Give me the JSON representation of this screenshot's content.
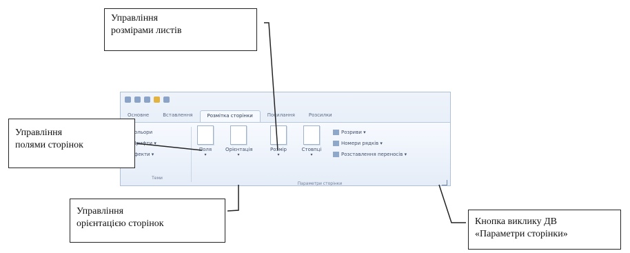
{
  "ribbon": {
    "tabs": [
      "Основне",
      "Вставлення",
      "Розмітка сторінки",
      "Посилання",
      "Розсилки"
    ],
    "themes": {
      "items": [
        "Кольори",
        "Шрифти ▾",
        "Ефекти ▾"
      ],
      "label": "Теми"
    },
    "page_setup": {
      "buttons": [
        "Поля",
        "Орієнтація",
        "Розмір",
        "Стовпці"
      ],
      "small_items": [
        "Розриви ▾",
        "Номери рядків ▾",
        "Розставлення переносів ▾"
      ],
      "label": "Параметри сторінки"
    }
  },
  "callouts": {
    "sheet_size": [
      "Управління",
      "розмірами листів"
    ],
    "margins": [
      "Управління",
      "полями сторінок"
    ],
    "orientation": [
      "Управління",
      "орієнтацією сторінок"
    ],
    "dialog_launcher": [
      "Кнопка виклику ДВ",
      "«Параметри сторінки»"
    ]
  },
  "colors": {
    "ribbon_bg": "#dfe8f5",
    "ribbon_border": "#aebfd6",
    "callout_border": "#222222"
  },
  "icons": [
    "undo-icon",
    "redo-icon",
    "save-icon",
    "margins-icon",
    "orientation-icon",
    "size-icon",
    "columns-icon",
    "dialog-launcher-icon"
  ]
}
